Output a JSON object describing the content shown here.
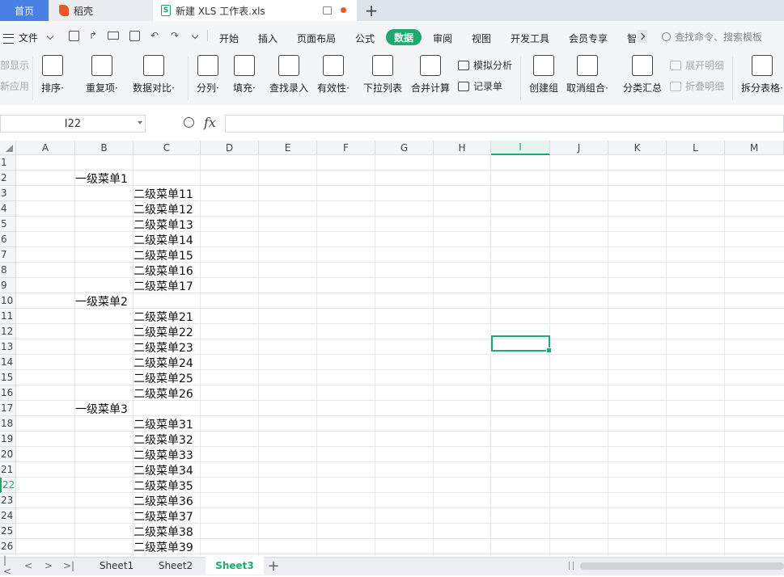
{
  "tabs": {
    "home": "首页",
    "docer": "稻壳",
    "file": "新建 XLS 工作表.xls",
    "file_icon": "S"
  },
  "menu": {
    "file": "文件",
    "items": [
      "开始",
      "插入",
      "页面布局",
      "公式",
      "数据",
      "审阅",
      "视图",
      "开发工具",
      "会员专享",
      "智"
    ],
    "search": "查找命令、搜索模板"
  },
  "ribbon": {
    "left_partial_1": "部显示",
    "left_partial_2": "新应用",
    "buttons": [
      {
        "id": "sort",
        "label": "排序·",
        "icon": "sort-icon"
      },
      {
        "id": "dup",
        "label": "重复项·",
        "icon": "duplicates-icon"
      },
      {
        "id": "compare",
        "label": "数据对比·",
        "icon": "compare-icon"
      },
      {
        "id": "split",
        "label": "分列·",
        "icon": "split-column-icon"
      },
      {
        "id": "fill",
        "label": "填充·",
        "icon": "fill-icon"
      },
      {
        "id": "lookup",
        "label": "查找录入",
        "icon": "lookup-icon"
      },
      {
        "id": "validity",
        "label": "有效性·",
        "icon": "validity-icon"
      },
      {
        "id": "dropdown",
        "label": "下拉列表",
        "icon": "dropdown-list-icon"
      },
      {
        "id": "merge",
        "label": "合并计算",
        "icon": "merge-calc-icon"
      },
      {
        "id": "group",
        "label": "创建组",
        "icon": "group-icon"
      },
      {
        "id": "ungroup",
        "label": "取消组合·",
        "icon": "ungroup-icon"
      },
      {
        "id": "subtotal",
        "label": "分类汇总",
        "icon": "subtotal-icon"
      },
      {
        "id": "splittable",
        "label": "拆分表格·",
        "icon": "split-table-icon"
      }
    ],
    "simulate": "模拟分析",
    "record": "记录单",
    "expand": "展开明细",
    "collapse": "折叠明细"
  },
  "formula": {
    "namebox": "I22",
    "fx": "fx"
  },
  "columns": [
    "A",
    "B",
    "C",
    "D",
    "E",
    "F",
    "G",
    "H",
    "I",
    "J",
    "K",
    "L",
    "M"
  ],
  "selected_column": "I",
  "rows": [
    "1",
    "2",
    "3",
    "4",
    "5",
    "6",
    "7",
    "8",
    "9",
    "10",
    "11",
    "12",
    "13",
    "14",
    "15",
    "16",
    "17",
    "18",
    "19",
    "20",
    "21",
    "22",
    "23",
    "24",
    "25",
    "26"
  ],
  "selected_row": "22",
  "cells": {
    "B2": "一级菜单1",
    "C3": "二级菜单11",
    "C4": "二级菜单12",
    "C5": "二级菜单13",
    "C6": "二级菜单14",
    "C7": "二级菜单15",
    "C8": "二级菜单16",
    "C9": "二级菜单17",
    "B10": "一级菜单2",
    "C11": "二级菜单21",
    "C12": "二级菜单22",
    "C13": "二级菜单23",
    "C14": "二级菜单24",
    "C15": "二级菜单25",
    "C16": "二级菜单26",
    "B17": "一级菜单3",
    "C18": "二级菜单31",
    "C19": "二级菜单32",
    "C20": "二级菜单33",
    "C21": "二级菜单34",
    "C22": "二级菜单35",
    "C23": "二级菜单36",
    "C24": "二级菜单37",
    "C25": "二级菜单38",
    "C26": "二级菜单39"
  },
  "sheets": [
    "Sheet1",
    "Sheet2",
    "Sheet3"
  ],
  "active_sheet": "Sheet3",
  "accent_color": "#1fa971"
}
